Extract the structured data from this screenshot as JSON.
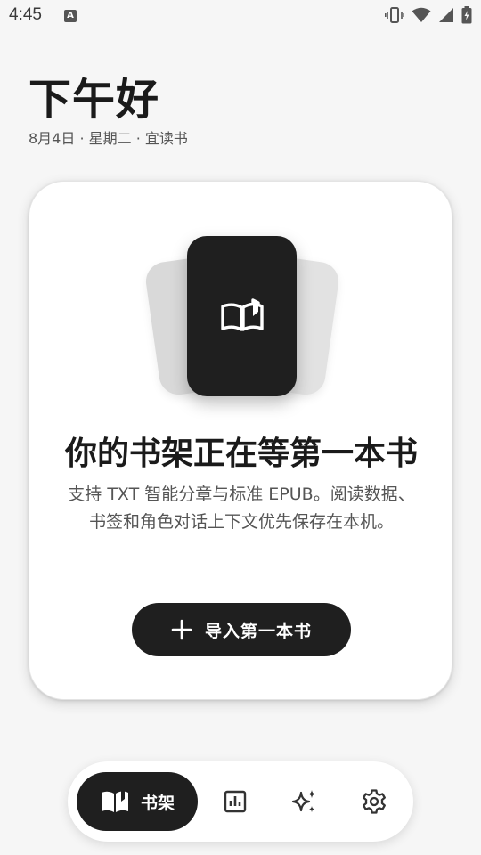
{
  "status_bar": {
    "time": "4:45",
    "notification_letter": "A",
    "icons": [
      "vibrate-icon",
      "wifi-icon",
      "signal-icon",
      "battery-icon"
    ]
  },
  "header": {
    "greeting": "下午好",
    "date_line": "8月4日 · 星期二 · 宜读书"
  },
  "empty_state": {
    "illustration_icon": "open-book-icon",
    "title": "你的书架正在等第一本书",
    "description": "支持 TXT 智能分章与标准 EPUB。阅读数据、书签和角色对话上下文优先保存在本机。",
    "import_button_label": "导入第一本书",
    "import_button_icon": "plus-icon"
  },
  "bottom_nav": {
    "items": [
      {
        "label": "书架",
        "icon": "bookshelf-icon",
        "active": true
      },
      {
        "label": "",
        "icon": "stats-icon",
        "active": false
      },
      {
        "label": "",
        "icon": "sparkle-icon",
        "active": false
      },
      {
        "label": "",
        "icon": "gear-icon",
        "active": false
      }
    ]
  },
  "colors": {
    "background": "#f6f6f6",
    "card": "#ffffff",
    "primary_dark": "#1f1f1f",
    "text_secondary": "#555555"
  }
}
